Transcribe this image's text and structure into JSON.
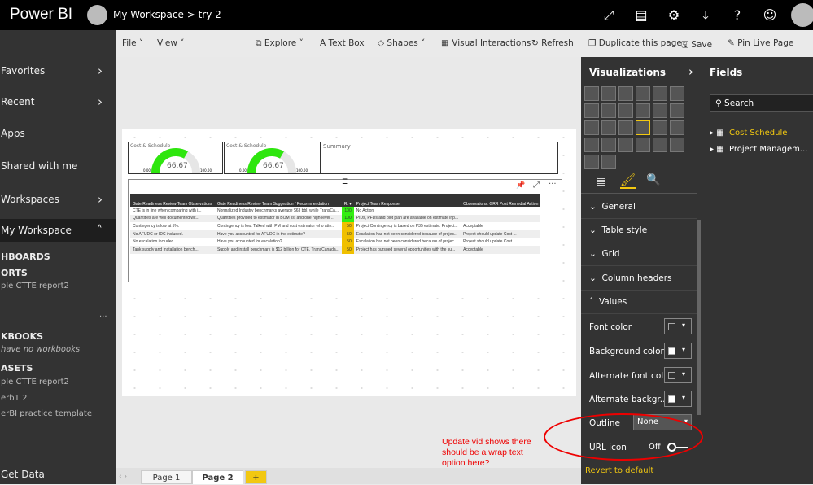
{
  "header": {
    "brand": "Power BI",
    "workspace": "My Workspace",
    "separator": ">",
    "report": "try 2",
    "icons": [
      "expand-icon",
      "comment-icon",
      "gear-icon",
      "download-icon",
      "help-icon",
      "smiley-icon",
      "avatar"
    ]
  },
  "nav": {
    "items": [
      {
        "label": "Favorites"
      },
      {
        "label": "Recent"
      },
      {
        "label": "Apps"
      },
      {
        "label": "Shared with me"
      },
      {
        "label": "Workspaces"
      },
      {
        "label": "My Workspace"
      }
    ],
    "dashboards": "HBOARDS",
    "reports": "ORTS",
    "report_item": "ple CTTE report2",
    "more": "...",
    "workbooks": "KBOOKS",
    "no_workbooks": "have no workbooks",
    "datasets": "ASETS",
    "dataset_items": [
      "ple CTTE report2",
      "erb1 2",
      "erBI practice template"
    ],
    "get_data": "Get Data"
  },
  "toolbar": {
    "file": "File",
    "view": "View",
    "explore": "Explore",
    "textbox": "Text Box",
    "shapes": "Shapes",
    "interactions": "Visual Interactions",
    "refresh": "Refresh",
    "duplicate": "Duplicate this page",
    "save": "Save",
    "pin": "Pin Live Page"
  },
  "cards": [
    {
      "title": "Cost & Schedule",
      "value": "66.67",
      "min": "0.00",
      "max": "100.00",
      "fraction": 0.6667
    },
    {
      "title": "Cost & Schedule",
      "value": "66.67",
      "min": "0.00",
      "max": "100.00",
      "fraction": 0.6667
    },
    {
      "title": "Summary"
    }
  ],
  "table": {
    "headers": [
      "Gate Readiness Review Team Observations",
      "Gate Readiness Review Team Suggestion / Recommendation",
      "R.",
      "Project Team Response",
      "Observations: GRR Post Remedial Action"
    ],
    "rows": [
      [
        "CTE is in line when comparing with i...",
        "Normalized Industry benchmarks average $63 bbl. while TransCa...",
        "100",
        "No Action",
        ""
      ],
      [
        "Quantities are well documented wit...",
        "Quantities provided to estimator in BOM list and one high-level ...",
        "100",
        "PIDs, PFDs and plot plan are available on estimate inp...",
        ""
      ],
      [
        "Contingency is low at 5%.",
        "Contingency is low. Talked with PM and cost estimator who atte...",
        "50",
        "Project Contingency is based on P35 estimate. Project...",
        "Acceptable"
      ],
      [
        "No AFUDC or IDC included.",
        "Have you accounted for AFUDC in the estimate?",
        "50",
        "Escalation has not been considered because of projec...",
        "Project should update Cost ..."
      ],
      [
        "No escalation included.",
        "Have you accounted for escalation?",
        "50",
        "Escalation has not been considered because of projec...",
        "Project should update Cost ..."
      ],
      [
        "Tank supply and Installation bench...",
        "Supply and install benchmark is $12 billion for CTE. TransCanada...",
        "50",
        "Project has pursued several opportunities with the su...",
        "Acceptable"
      ]
    ],
    "colors": {
      "100": "#33ee11",
      "50": "#f0c000"
    }
  },
  "viz": {
    "title": "Visualizations",
    "sections": [
      "General",
      "Table style",
      "Grid",
      "Column headers",
      "Values"
    ],
    "props": {
      "font_color": "Font color",
      "bg_color": "Background color",
      "alt_font": "Alternate font col...",
      "alt_bg": "Alternate backgr...",
      "outline": "Outline",
      "outline_value": "None",
      "url_icon": "URL icon",
      "url_value": "Off"
    },
    "revert": "Revert to default"
  },
  "fields": {
    "title": "Fields",
    "search": "Search",
    "tables": [
      "Cost Schedule",
      "Project Managem..."
    ]
  },
  "annotation": "Update vid shows there should be a wrap text option here?",
  "tabs": [
    "Page 1",
    "Page 2",
    "+"
  ],
  "accent": "#f2c811"
}
